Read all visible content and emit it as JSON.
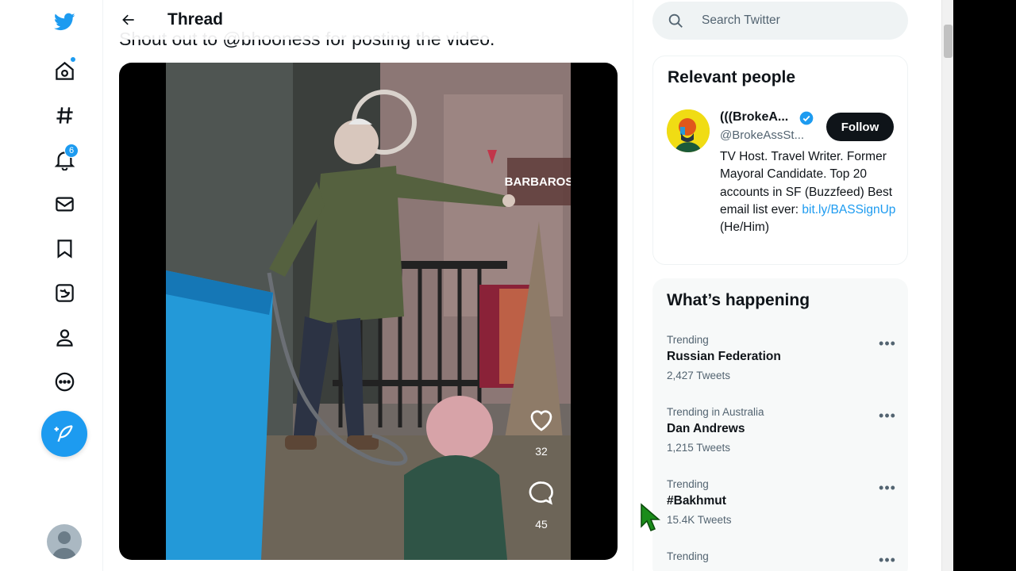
{
  "nav": {
    "items": [
      {
        "icon": "twitter-logo-icon"
      },
      {
        "icon": "home-icon"
      },
      {
        "icon": "explore-hash-icon"
      },
      {
        "icon": "notifications-bell-icon",
        "badge": "6"
      },
      {
        "icon": "messages-envelope-icon"
      },
      {
        "icon": "bookmark-icon"
      },
      {
        "icon": "twitter-blue-icon"
      },
      {
        "icon": "profile-icon"
      },
      {
        "icon": "more-circle-icon"
      }
    ],
    "tweet_button_icon": "compose-feather-icon",
    "brand_color": "#1d9bf0"
  },
  "header": {
    "title": "Thread"
  },
  "tweet": {
    "text_partial": "Shout out to @bhooness for posting the video.",
    "video": {
      "likes": "32",
      "comments": "45",
      "storefront_sign": "BARBAROS"
    }
  },
  "search": {
    "placeholder": "Search Twitter"
  },
  "relevant_people": {
    "title": "Relevant people",
    "person": {
      "name": "(((BrokeA...",
      "handle": "@BrokeAssSt...",
      "follow_label": "Follow",
      "bio_text": "TV Host. Travel Writer. Former Mayoral Candidate. Top 20 accounts in SF (Buzzfeed) Best email list ever: ",
      "bio_link": "bit.ly/BASSignUp",
      "bio_suffix": "(He/Him)"
    }
  },
  "whats_happening": {
    "title": "What’s happening",
    "trends": [
      {
        "meta": "Trending",
        "name": "Russian Federation",
        "count": "2,427 Tweets"
      },
      {
        "meta": "Trending in Australia",
        "name": "Dan Andrews",
        "count": "1,215 Tweets"
      },
      {
        "meta": "Trending",
        "name": "#Bakhmut",
        "count": "15.4K Tweets"
      },
      {
        "meta": "Trending",
        "name": "",
        "count": ""
      }
    ]
  }
}
